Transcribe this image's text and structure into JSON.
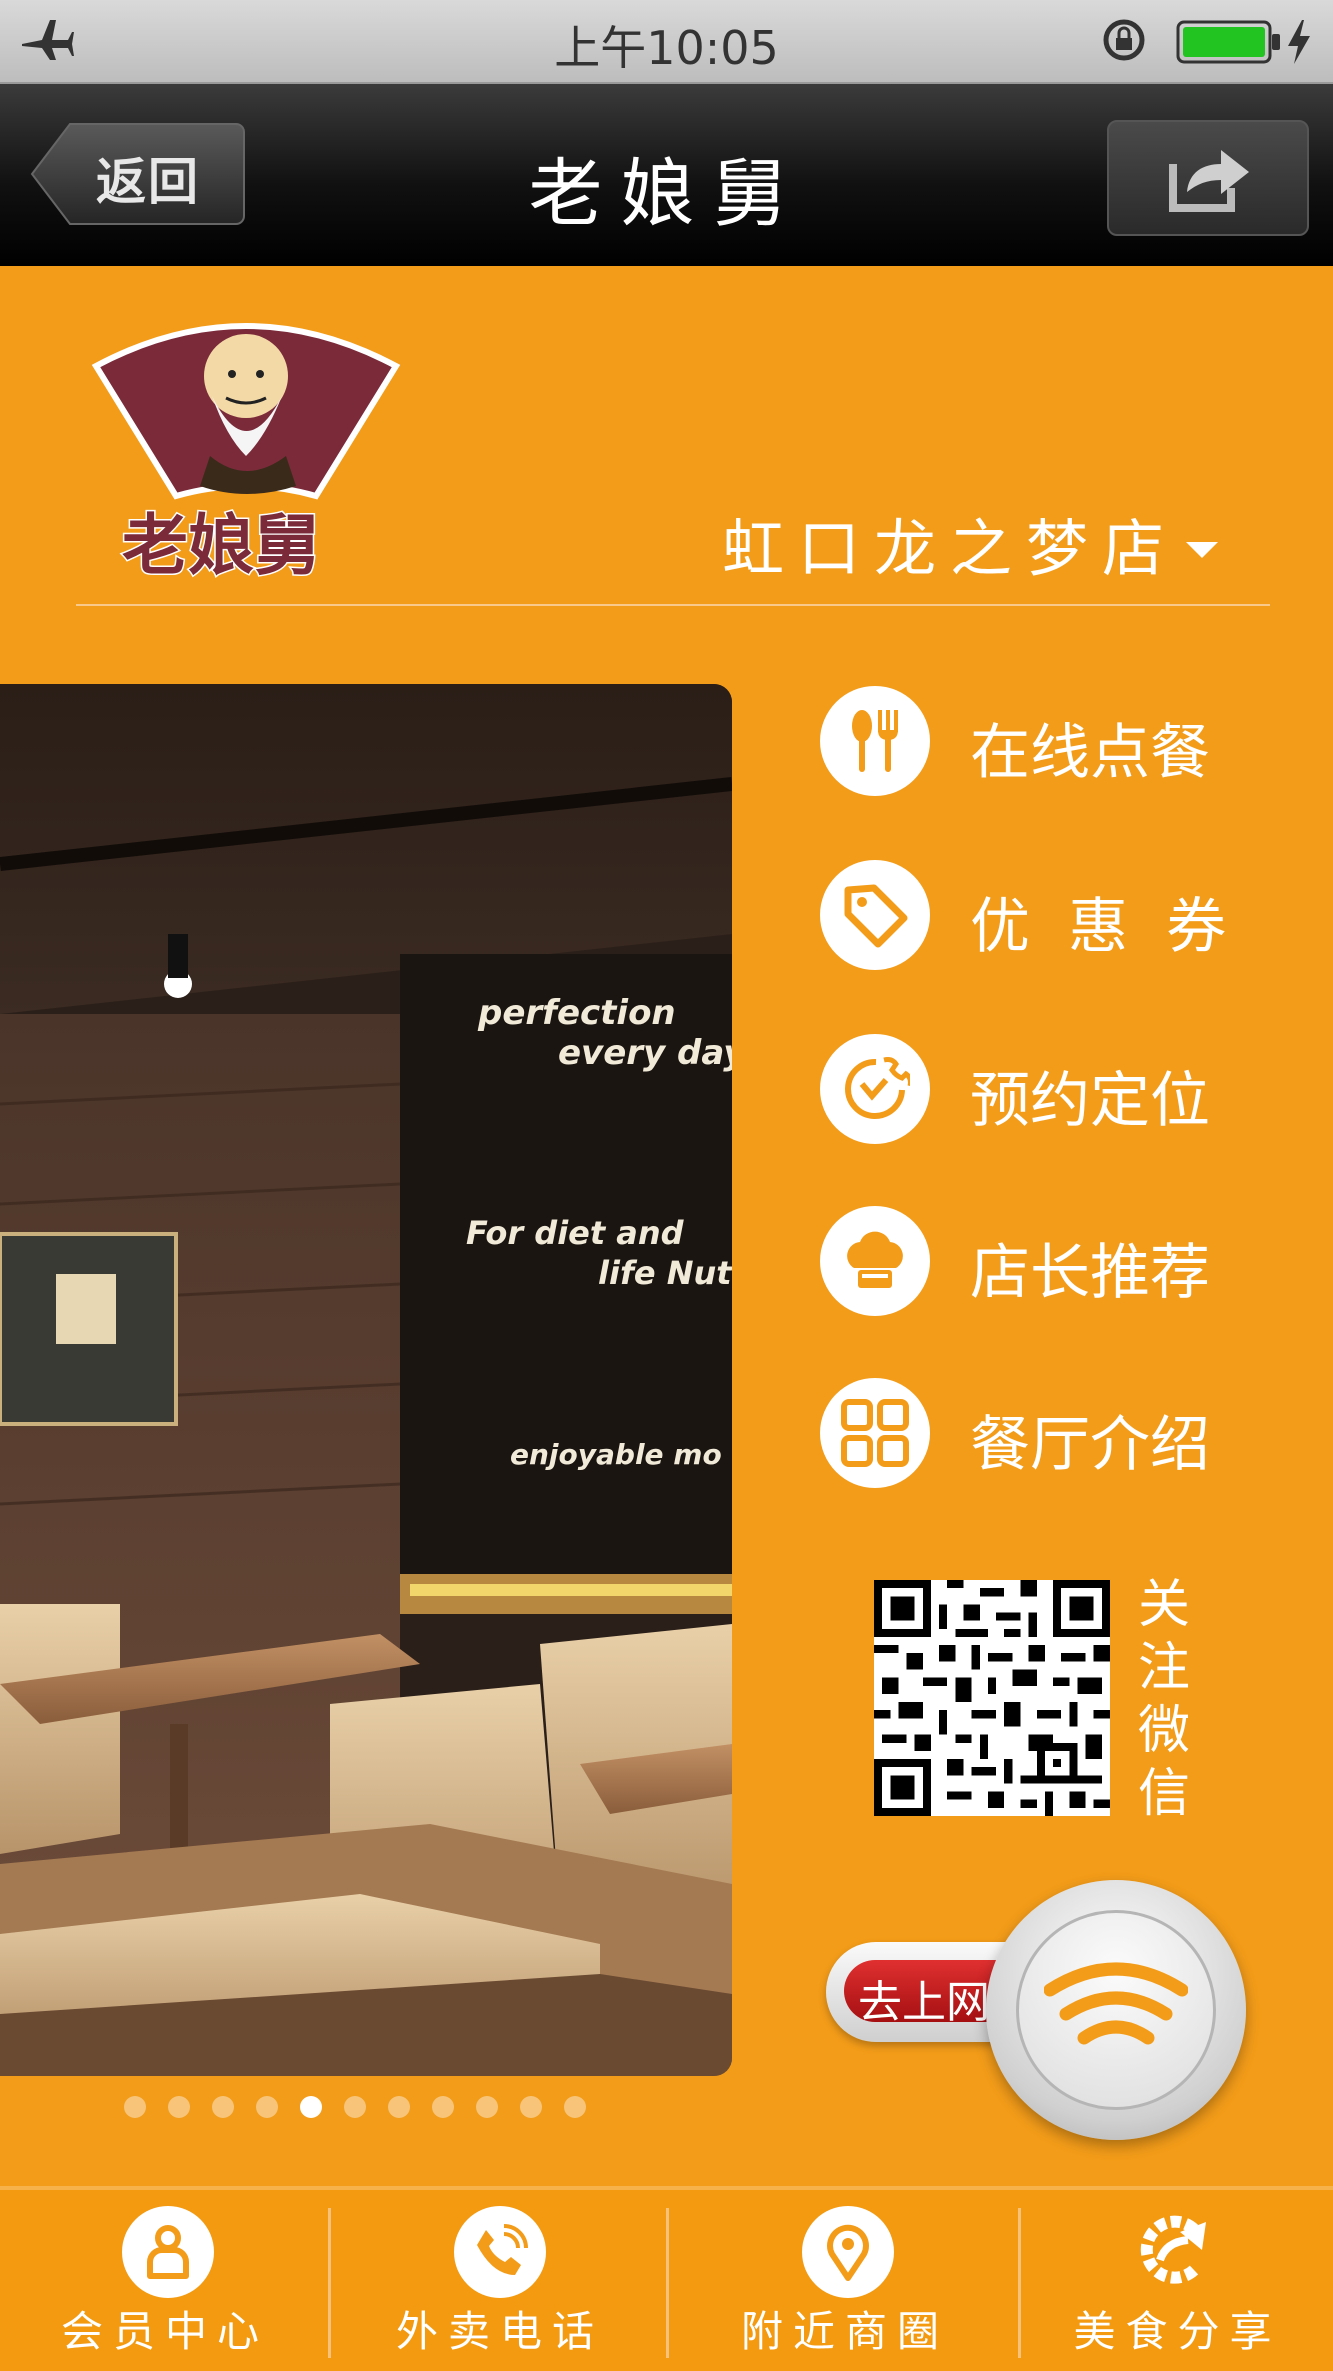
{
  "status_bar": {
    "time": "上午10:05",
    "icons": [
      "airplane-icon",
      "rotation-lock-icon",
      "battery-icon",
      "charging-icon"
    ],
    "battery_color": "#22c422"
  },
  "nav": {
    "back_label": "返回",
    "title": "老娘舅",
    "share_icon": "share-icon"
  },
  "brand": {
    "logo_text": "老娘舅",
    "logo_color": "#7b2a3a"
  },
  "store_selector": {
    "selected": "虹口龙之梦店"
  },
  "menu": [
    {
      "label": "在线点餐",
      "icon": "fork-knife-icon"
    },
    {
      "label": "优  惠  券",
      "icon": "coupon-tag-icon"
    },
    {
      "label": "预约定位",
      "icon": "reservation-clock-icon"
    },
    {
      "label": "店长推荐",
      "icon": "chef-hat-icon"
    },
    {
      "label": "餐厅介绍",
      "icon": "grid-icon"
    }
  ],
  "qr": {
    "label": "关注微信"
  },
  "wifi": {
    "label": "去上网"
  },
  "carousel": {
    "total": 11,
    "active_index": 4
  },
  "bottom_nav": [
    {
      "label": "会员中心",
      "icon": "member-icon"
    },
    {
      "label": "外卖电话",
      "icon": "phone-icon"
    },
    {
      "label": "附近商圈",
      "icon": "location-pin-icon"
    },
    {
      "label": "美食分享",
      "icon": "share-arrow-icon"
    }
  ],
  "colors": {
    "accent": "#f39c19",
    "accent_dark": "#f39a10",
    "icon_color": "#f39c19"
  }
}
